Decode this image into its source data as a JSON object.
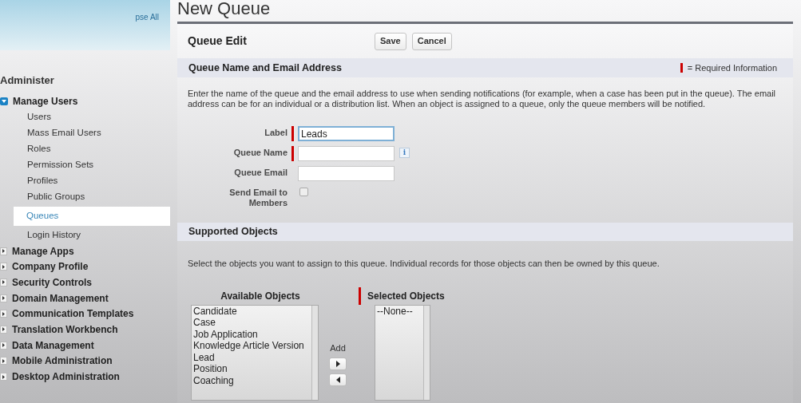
{
  "sidebar": {
    "collapse_link": "pse All",
    "heading": "Administer",
    "groups": [
      {
        "label": "Manage Users",
        "expanded": true,
        "children": [
          {
            "label": "Users",
            "selected": false
          },
          {
            "label": "Mass Email Users",
            "selected": false
          },
          {
            "label": "Roles",
            "selected": false
          },
          {
            "label": "Permission Sets",
            "selected": false
          },
          {
            "label": "Profiles",
            "selected": false
          },
          {
            "label": "Public Groups",
            "selected": false
          },
          {
            "label": "Queues",
            "selected": true
          },
          {
            "label": "Login History",
            "selected": false
          }
        ]
      },
      {
        "label": "Manage Apps",
        "expanded": false
      },
      {
        "label": "Company Profile",
        "expanded": false
      },
      {
        "label": "Security Controls",
        "expanded": false
      },
      {
        "label": "Domain Management",
        "expanded": false
      },
      {
        "label": "Communication Templates",
        "expanded": false
      },
      {
        "label": "Translation Workbench",
        "expanded": false
      },
      {
        "label": "Data Management",
        "expanded": false
      },
      {
        "label": "Mobile Administration",
        "expanded": false
      },
      {
        "label": "Desktop Administration",
        "expanded": false
      }
    ]
  },
  "page_title": "New Queue",
  "edit": {
    "title": "Queue Edit",
    "buttons": [
      "Save",
      "Cancel"
    ]
  },
  "name_section": {
    "title": "Queue Name and Email Address",
    "required_legend": "= Required Information",
    "description": "Enter the name of the queue and the email address to use when sending notifications (for example, when a case has been put in the queue). The email address can be for an individual or a distribution list. When an object is assigned to a queue, only the queue members will be notified.",
    "fields": [
      {
        "kind": "text",
        "label": "Label",
        "value": "Leads",
        "required": true,
        "focused": true
      },
      {
        "kind": "text",
        "label": "Queue Name",
        "required": true,
        "focused": false,
        "info_icon": "i"
      },
      {
        "kind": "text",
        "label": "Queue Email",
        "required": false,
        "focused": false
      },
      {
        "kind": "checkbox",
        "label": "Send Email to Members",
        "checked": false,
        "required": false
      }
    ]
  },
  "objects_section": {
    "title": "Supported Objects",
    "description": "Select the objects you want to assign to this queue. Individual records for those objects can then be owned by this queue.",
    "available": {
      "title": "Available Objects",
      "required": false,
      "items": [
        "Candidate",
        "Case",
        "Job Application",
        "Knowledge Article Version",
        "Lead",
        "Position",
        "Coaching"
      ]
    },
    "add_label": "Add",
    "selected": {
      "title": "Selected Objects",
      "required": true,
      "items": [
        "--None--"
      ]
    }
  }
}
